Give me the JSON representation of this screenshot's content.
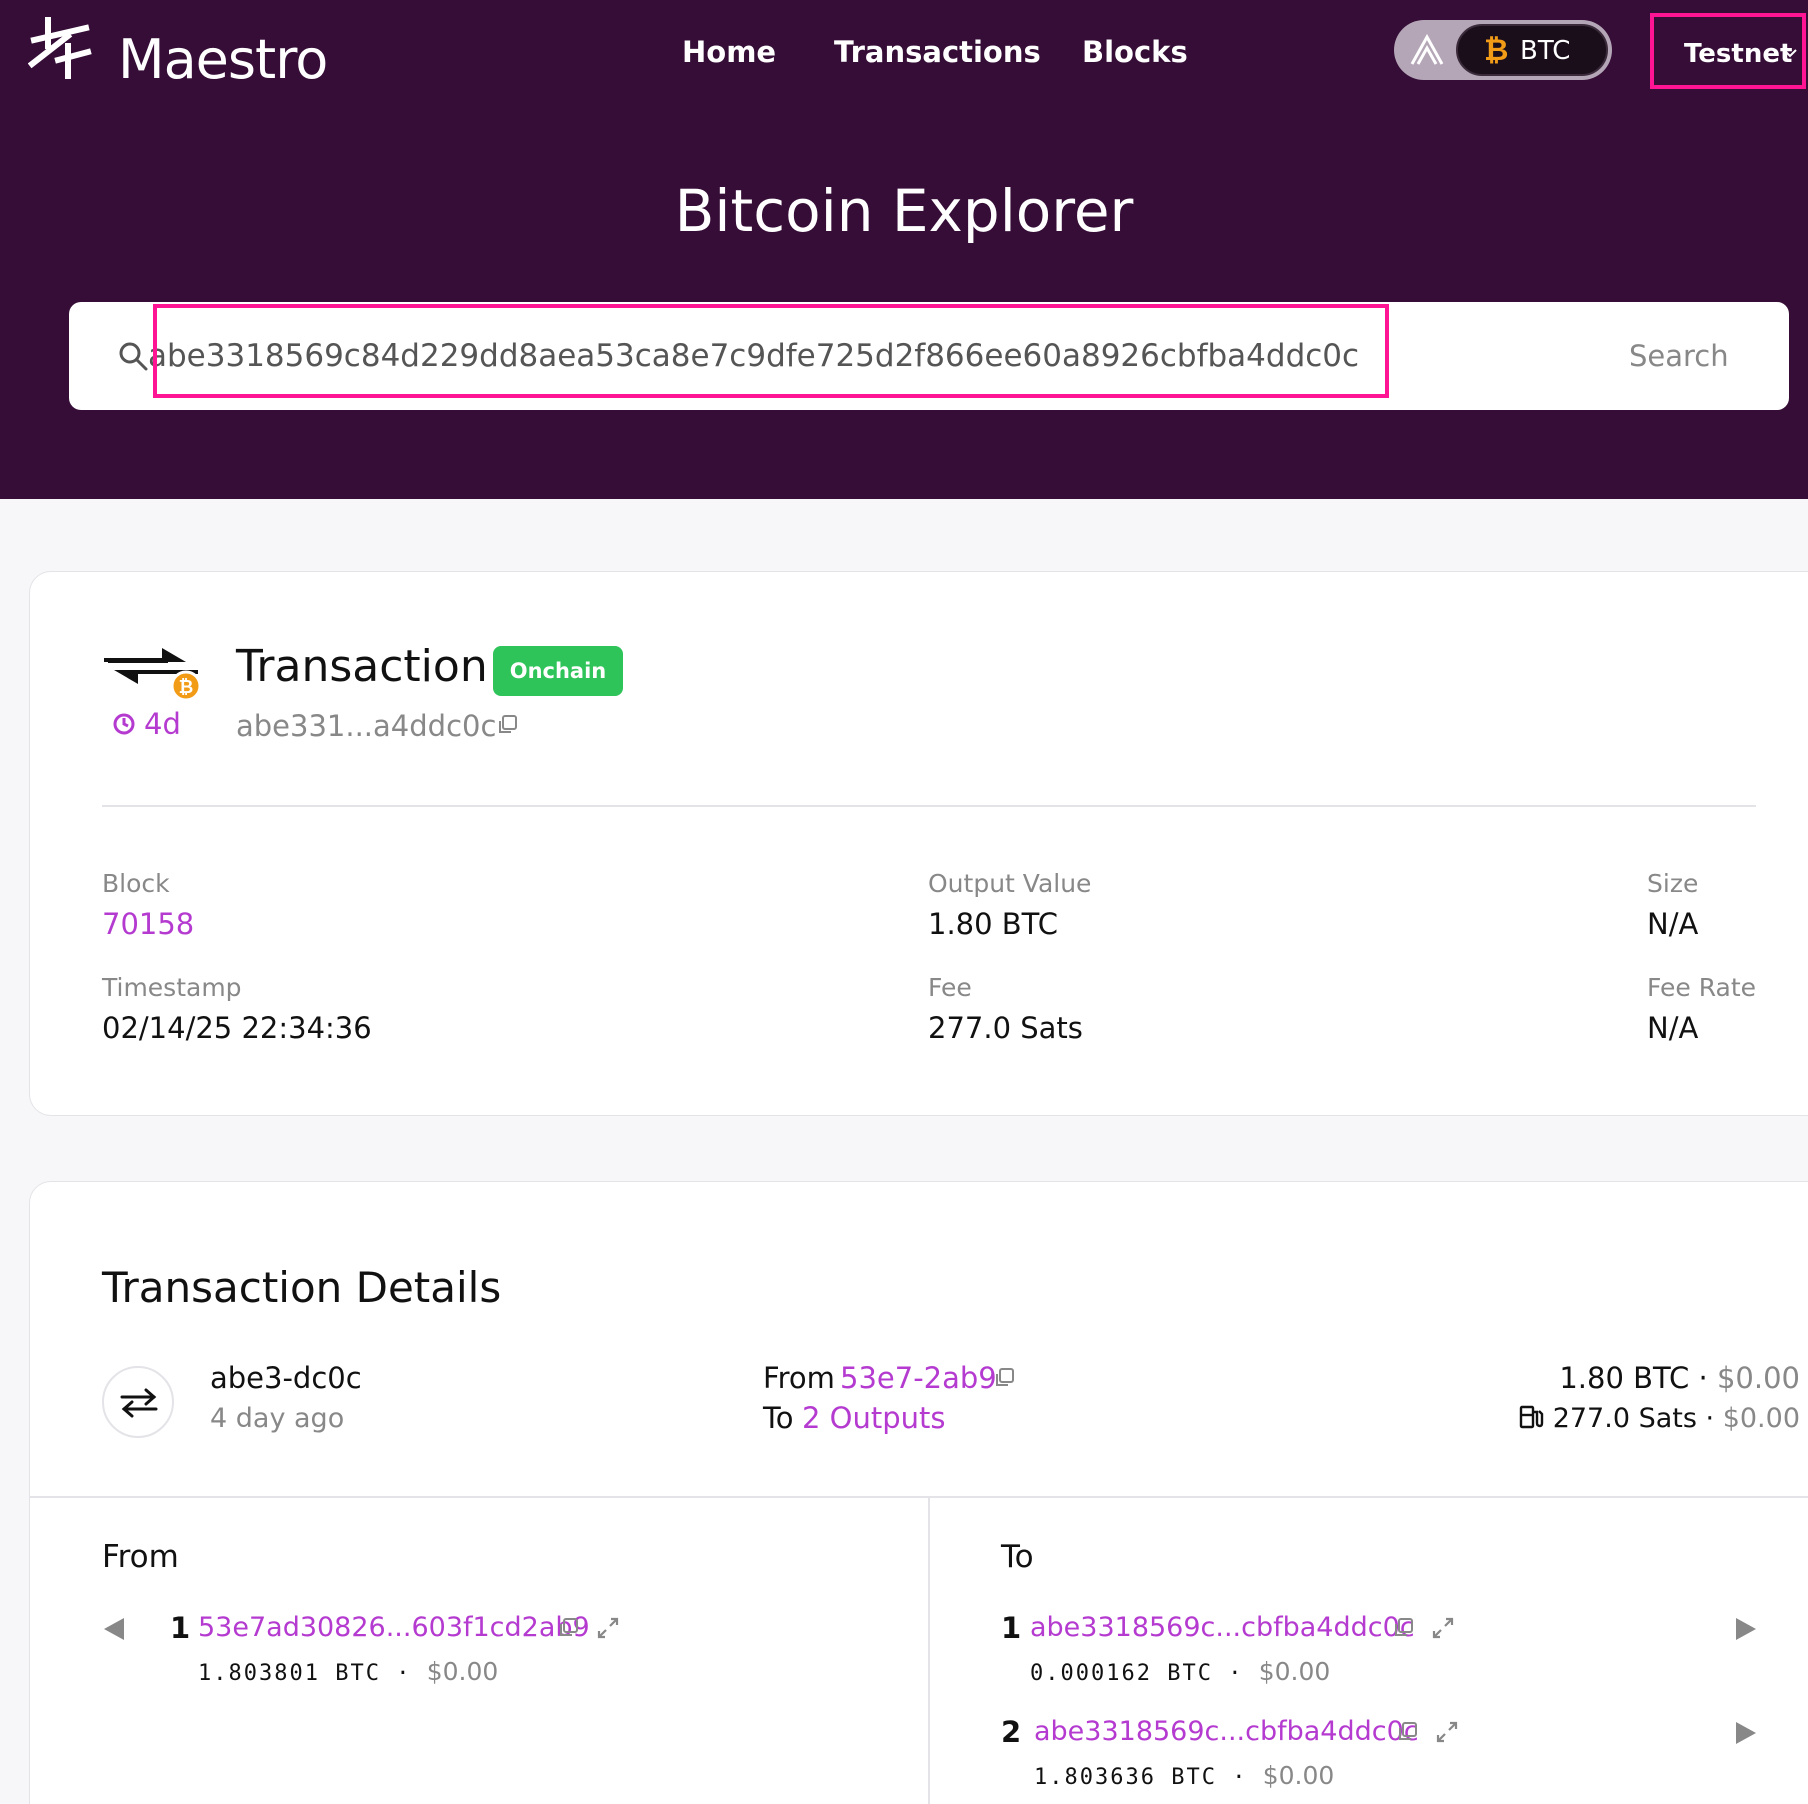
{
  "brand": {
    "name": "Maestro"
  },
  "nav": {
    "home": "Home",
    "transactions": "Transactions",
    "blocks": "Blocks"
  },
  "chain": {
    "label": "BTC"
  },
  "network": {
    "label": "Testnet"
  },
  "hero": {
    "title": "Bitcoin Explorer"
  },
  "search": {
    "value": "abe3318569c84d229dd8aea53ca8e7c9dfe725d2f866ee60a8926cbfba4ddc0c",
    "button": "Search"
  },
  "transaction": {
    "title": "Transaction",
    "status": "Onchain",
    "age": "4d",
    "hash_short": "abe331...a4ddc0c"
  },
  "stats": {
    "block_label": "Block",
    "block_value": "70158",
    "output_value_label": "Output Value",
    "output_value": "1.80 BTC",
    "size_label": "Size",
    "size_value": "N/A",
    "timestamp_label": "Timestamp",
    "timestamp_value": "02/14/25 22:34:36",
    "fee_label": "Fee",
    "fee_value": "277.0 Sats",
    "fee_rate_label": "Fee Rate",
    "fee_rate_value": "N/A"
  },
  "details": {
    "title": "Transaction Details",
    "summary": {
      "tx_short": "abe3-dc0c",
      "age": "4 day ago",
      "from_label": "From",
      "from_value": "53e7-2ab9",
      "to_label": "To",
      "to_value": "2 Outputs",
      "amount": "1.80 BTC",
      "dot": "·",
      "amount_usd": "$0.00",
      "fee": "277.0 Sats",
      "fee_usd": "$0.00"
    },
    "from_section": {
      "label": "From",
      "items": [
        {
          "index": "1",
          "hash": "53e7ad30826...603f1cd2ab9",
          "amount": "1.803801 BTC",
          "usd": "$0.00"
        }
      ]
    },
    "to_section": {
      "label": "To",
      "items": [
        {
          "index": "1",
          "hash": "abe3318569c...cbfba4ddc0c",
          "amount": "0.000162 BTC",
          "usd": "$0.00"
        },
        {
          "index": "2",
          "hash": "abe3318569c...cbfba4ddc0c",
          "amount": "1.803636 BTC",
          "usd": "$0.00"
        }
      ]
    }
  },
  "colors": {
    "hero_bg": "#350d37",
    "accent": "#b43ad0",
    "badge": "#2fc45a",
    "highlight": "#ff1493",
    "btc": "#f29b17"
  },
  "icons": [
    "maestro-logo-icon",
    "ethereum-icon",
    "bitcoin-icon",
    "chevron-down-icon",
    "search-icon",
    "transaction-icon",
    "clock-icon",
    "copy-icon",
    "swap-icon",
    "fuel-icon",
    "expand-icon",
    "arrow-left-icon",
    "arrow-right-icon"
  ]
}
